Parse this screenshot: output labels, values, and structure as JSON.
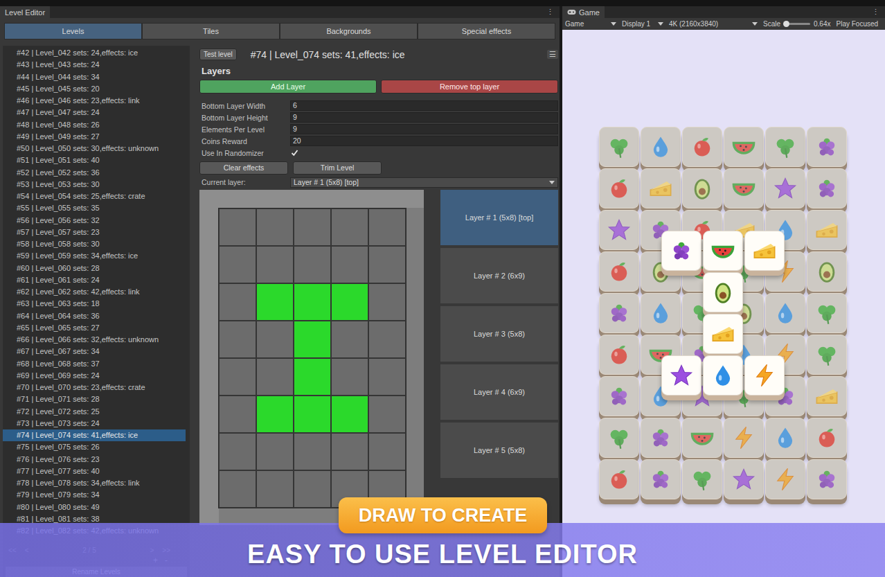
{
  "editor": {
    "title": "Level Editor",
    "menu": "⋮",
    "tabs": [
      {
        "label": "Levels",
        "selected": true
      },
      {
        "label": "Tiles",
        "selected": false
      },
      {
        "label": "Backgrounds",
        "selected": false
      },
      {
        "label": "Special effects",
        "selected": false
      }
    ],
    "levels": [
      {
        "label": "#42 | Level_042 sets: 24,effects: ice",
        "selected": false
      },
      {
        "label": "#43 | Level_043 sets: 24",
        "selected": false
      },
      {
        "label": "#44 | Level_044 sets: 34",
        "selected": false
      },
      {
        "label": "#45 | Level_045 sets: 20",
        "selected": false
      },
      {
        "label": "#46 | Level_046 sets: 23,effects: link",
        "selected": false
      },
      {
        "label": "#47 | Level_047 sets: 24",
        "selected": false
      },
      {
        "label": "#48 | Level_048 sets: 26",
        "selected": false
      },
      {
        "label": "#49 | Level_049 sets: 27",
        "selected": false
      },
      {
        "label": "#50 | Level_050 sets: 30,effects: unknown",
        "selected": false
      },
      {
        "label": "#51 | Level_051 sets: 40",
        "selected": false
      },
      {
        "label": "#52 | Level_052 sets: 36",
        "selected": false
      },
      {
        "label": "#53 | Level_053 sets: 30",
        "selected": false
      },
      {
        "label": "#54 | Level_054 sets: 25,effects: crate",
        "selected": false
      },
      {
        "label": "#55 | Level_055 sets: 35",
        "selected": false
      },
      {
        "label": "#56 | Level_056 sets: 32",
        "selected": false
      },
      {
        "label": "#57 | Level_057 sets: 23",
        "selected": false
      },
      {
        "label": "#58 | Level_058 sets: 30",
        "selected": false
      },
      {
        "label": "#59 | Level_059 sets: 34,effects: ice",
        "selected": false
      },
      {
        "label": "#60 | Level_060 sets: 28",
        "selected": false
      },
      {
        "label": "#61 | Level_061 sets: 24",
        "selected": false
      },
      {
        "label": "#62 | Level_062 sets: 42,effects: link",
        "selected": false
      },
      {
        "label": "#63 | Level_063 sets: 18",
        "selected": false
      },
      {
        "label": "#64 | Level_064 sets: 36",
        "selected": false
      },
      {
        "label": "#65 | Level_065 sets: 27",
        "selected": false
      },
      {
        "label": "#66 | Level_066 sets: 32,effects: unknown",
        "selected": false
      },
      {
        "label": "#67 | Level_067 sets: 34",
        "selected": false
      },
      {
        "label": "#68 | Level_068 sets: 37",
        "selected": false
      },
      {
        "label": "#69 | Level_069 sets: 24",
        "selected": false
      },
      {
        "label": "#70 | Level_070 sets: 23,effects: crate",
        "selected": false
      },
      {
        "label": "#71 | Level_071 sets: 28",
        "selected": false
      },
      {
        "label": "#72 | Level_072 sets: 25",
        "selected": false
      },
      {
        "label": "#73 | Level_073 sets: 24",
        "selected": false
      },
      {
        "label": "#74 | Level_074 sets: 41,effects: ice",
        "selected": true
      },
      {
        "label": "#75 | Level_075 sets: 26",
        "selected": false
      },
      {
        "label": "#76 | Level_076 sets: 23",
        "selected": false
      },
      {
        "label": "#77 | Level_077 sets: 40",
        "selected": false
      },
      {
        "label": "#78 | Level_078 sets: 34,effects: link",
        "selected": false
      },
      {
        "label": "#79 | Level_079 sets: 34",
        "selected": false
      },
      {
        "label": "#80 | Level_080 sets: 49",
        "selected": false
      },
      {
        "label": "#81 | Level_081 sets: 38",
        "selected": false
      },
      {
        "label": "#82 | Level_082 sets: 42,effects: unknown",
        "selected": false
      }
    ],
    "pager": {
      "first": "<<",
      "prev": "<",
      "page": "2 / 5",
      "next": ">",
      "last": ">>",
      "add": "+",
      "remove": "-",
      "rename": "Rename Levels"
    },
    "test_button": "Test level",
    "level_title": "#74 | Level_074 sets: 41,effects: ice",
    "level_menu": "☰",
    "layers_heading": "Layers",
    "add_layer": "Add Layer",
    "remove_layer": "Remove top layer",
    "fields": [
      {
        "label": "Bottom Layer Width",
        "value": "6",
        "kind": "text"
      },
      {
        "label": "Bottom Layer Height",
        "value": "9",
        "kind": "text"
      },
      {
        "label": "Elements Per Level",
        "value": "9",
        "kind": "text"
      },
      {
        "label": "Coins Reward",
        "value": "20",
        "kind": "text"
      },
      {
        "label": "Use In Randomizer",
        "checked": true,
        "kind": "checkbox"
      }
    ],
    "clear_effects": "Clear effects",
    "trim_level": "Trim Level",
    "current_layer": {
      "label": "Current layer:",
      "value": "Layer # 1 (5x8) [top]"
    },
    "grid": {
      "rows": [
        [
          false,
          false,
          false,
          false,
          false
        ],
        [
          false,
          false,
          false,
          false,
          false
        ],
        [
          false,
          true,
          true,
          true,
          false
        ],
        [
          false,
          false,
          true,
          false,
          false
        ],
        [
          false,
          false,
          true,
          false,
          false
        ],
        [
          false,
          true,
          true,
          true,
          false
        ],
        [
          false,
          false,
          false,
          false,
          false
        ],
        [
          false,
          false,
          false,
          false,
          false
        ]
      ]
    },
    "layers": [
      {
        "label": "Layer # 1 (5x8) [top]",
        "selected": true
      },
      {
        "label": "Layer # 2 (6x9)",
        "selected": false
      },
      {
        "label": "Layer # 3 (5x8)",
        "selected": false
      },
      {
        "label": "Layer # 4 (6x9)",
        "selected": false
      },
      {
        "label": "Layer # 5 (5x8)",
        "selected": false
      }
    ]
  },
  "game": {
    "title": "Game",
    "menu": "⋮",
    "toolbar": {
      "view": "Game",
      "display": "Display 1",
      "resolution": "4K (2160x3840)",
      "scale_label": "Scale",
      "scale_level": 0.1,
      "scale_value": "0.64x",
      "play_focused": "Play Focused"
    },
    "lower_tiles": [
      {
        "kind": "clover",
        "locked": true
      },
      {
        "kind": "drop",
        "locked": true
      },
      {
        "kind": "apple",
        "locked": true
      },
      {
        "kind": "watermelon",
        "locked": true
      },
      {
        "kind": "clover",
        "locked": true
      },
      {
        "kind": "grape",
        "locked": true
      },
      {
        "kind": "apple",
        "locked": true
      },
      {
        "kind": "cheese",
        "locked": true
      },
      {
        "kind": "avocado",
        "locked": true
      },
      {
        "kind": "watermelon",
        "locked": true
      },
      {
        "kind": "star",
        "locked": true
      },
      {
        "kind": "grape",
        "locked": true
      },
      {
        "kind": "star",
        "locked": true
      },
      {
        "kind": "grape",
        "locked": true
      },
      {
        "kind": "apple",
        "locked": true
      },
      {
        "kind": "cheese",
        "locked": true
      },
      {
        "kind": "drop",
        "locked": true
      },
      {
        "kind": "cheese",
        "locked": true
      },
      {
        "kind": "apple",
        "locked": true
      },
      {
        "kind": "avocado",
        "locked": true
      },
      {
        "kind": "watermelon",
        "locked": true
      },
      {
        "kind": "clover",
        "locked": true
      },
      {
        "kind": "lightning",
        "locked": true
      },
      {
        "kind": "avocado",
        "locked": true
      },
      {
        "kind": "grape",
        "locked": true
      },
      {
        "kind": "drop",
        "locked": true
      },
      {
        "kind": "clover",
        "locked": true
      },
      {
        "kind": "avocado",
        "locked": true
      },
      {
        "kind": "drop",
        "locked": true
      },
      {
        "kind": "clover",
        "locked": true
      },
      {
        "kind": "apple",
        "locked": true
      },
      {
        "kind": "watermelon",
        "locked": true
      },
      {
        "kind": "grape",
        "locked": true
      },
      {
        "kind": "drop",
        "locked": true
      },
      {
        "kind": "lightning",
        "locked": true
      },
      {
        "kind": "clover",
        "locked": true
      },
      {
        "kind": "grape",
        "locked": true
      },
      {
        "kind": "drop",
        "locked": true
      },
      {
        "kind": "star",
        "locked": true
      },
      {
        "kind": "clover",
        "locked": true
      },
      {
        "kind": "grape",
        "locked": true
      },
      {
        "kind": "cheese",
        "locked": true
      },
      {
        "kind": "clover",
        "locked": true
      },
      {
        "kind": "grape",
        "locked": true
      },
      {
        "kind": "watermelon",
        "locked": true
      },
      {
        "kind": "lightning",
        "locked": true
      },
      {
        "kind": "drop",
        "locked": true
      },
      {
        "kind": "apple",
        "locked": true
      },
      {
        "kind": "apple",
        "locked": true
      },
      {
        "kind": "grape",
        "locked": true
      },
      {
        "kind": "clover",
        "locked": true
      },
      {
        "kind": "star",
        "locked": true
      },
      {
        "kind": "lightning",
        "locked": true
      },
      {
        "kind": "grape",
        "locked": true
      }
    ],
    "top_tiles": [
      {
        "kind": "grape",
        "locked": false
      },
      {
        "kind": "watermelon",
        "locked": false
      },
      {
        "kind": "cheese",
        "locked": false
      },
      {
        "kind": "avocado",
        "locked": false
      },
      {
        "kind": "cheese",
        "locked": false
      },
      {
        "kind": "star",
        "locked": false
      },
      {
        "kind": "drop",
        "locked": false
      },
      {
        "kind": "lightning",
        "locked": false
      }
    ]
  },
  "banner": {
    "badge": "DRAW TO CREATE",
    "headline": "EASY TO USE LEVEL EDITOR"
  }
}
